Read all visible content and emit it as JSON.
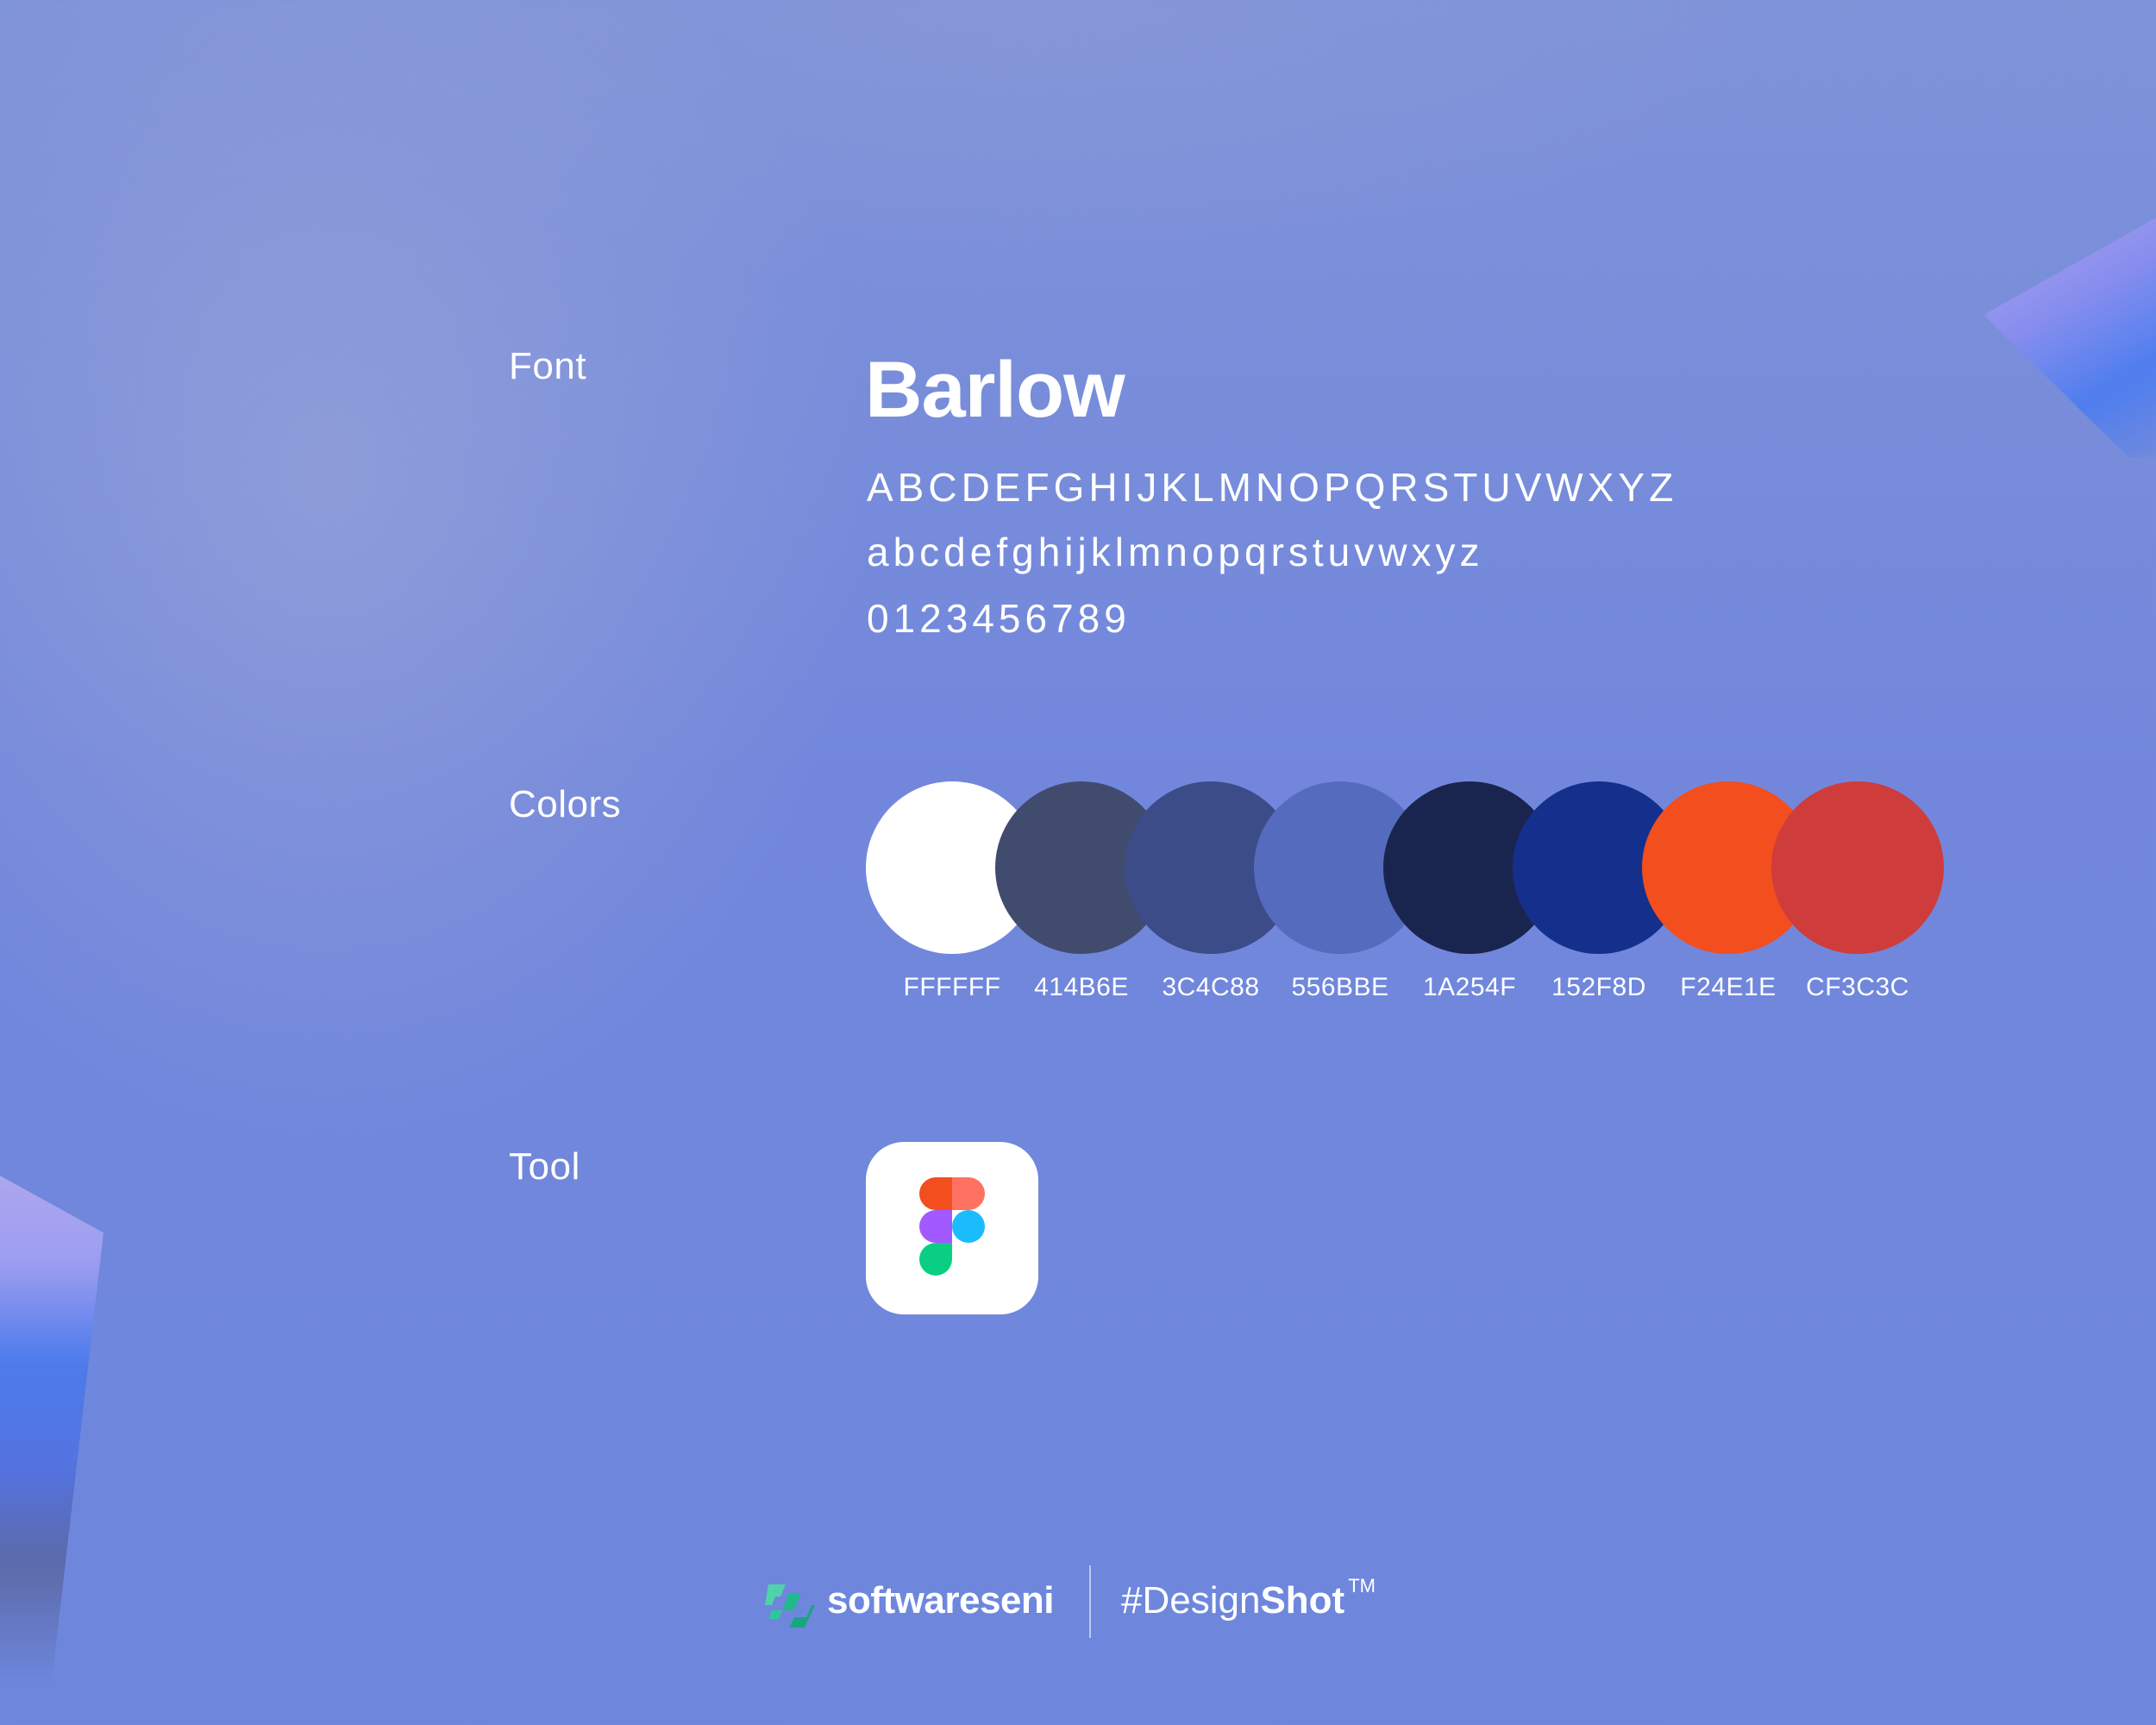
{
  "sections": {
    "font_label": "Font",
    "colors_label": "Colors",
    "tool_label": "Tool"
  },
  "font": {
    "name": "Barlow",
    "uppercase": "ABCDEFGHIJKLMNOPQRSTUVWXYZ",
    "lowercase": "abcdefghijklmnopqrstuvwxyz",
    "digits": "0123456789"
  },
  "colors": [
    {
      "hex": "#FFFFFF",
      "code": "FFFFFF"
    },
    {
      "hex": "#414B6E",
      "code": "414B6E"
    },
    {
      "hex": "#3C4C88",
      "code": "3C4C88"
    },
    {
      "hex": "#556BBE",
      "code": "556BBE"
    },
    {
      "hex": "#1A254F",
      "code": "1A254F"
    },
    {
      "hex": "#152F8D",
      "code": "152F8D"
    },
    {
      "hex": "#F24E1E",
      "code": "F24E1E"
    },
    {
      "hex": "#CF3C3C",
      "code": "CF3C3C"
    }
  ],
  "tool": {
    "icon": "figma-icon"
  },
  "footer": {
    "brand_icon": "softwareseni-logo-icon",
    "brand_name": "softwareseni",
    "hashtag_light": "#Design",
    "hashtag_bold": "Shot",
    "trademark": "TM"
  },
  "background": {
    "primary": "#6D87DD",
    "accent_purple": "#B3A9EF",
    "accent_blue": "#4D7BEC"
  }
}
